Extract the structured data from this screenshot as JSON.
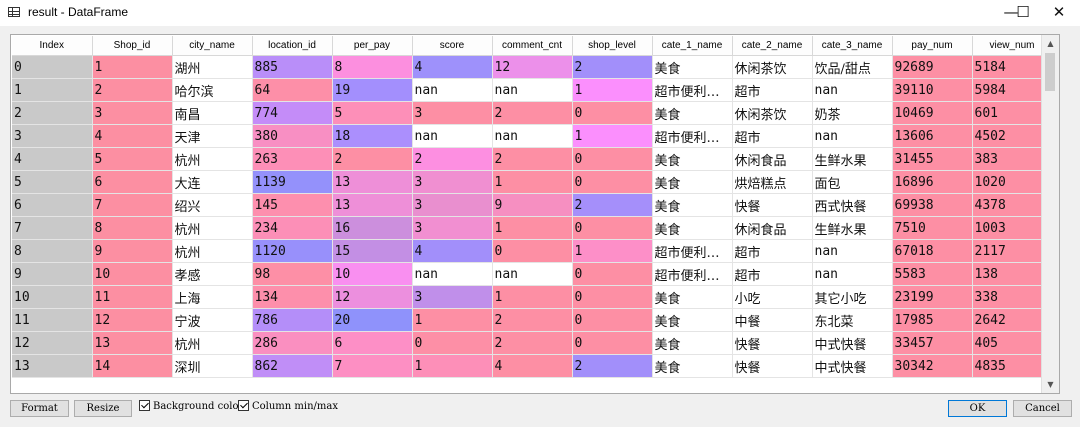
{
  "window": {
    "title": "result - DataFrame",
    "minimize": "—",
    "maximize": "☐",
    "close": "✕"
  },
  "table": {
    "columns": [
      "Index",
      "Shop_id",
      "city_name",
      "location_id",
      "per_pay",
      "score",
      "comment_cnt",
      "shop_level",
      "cate_1_name",
      "cate_2_name",
      "cate_3_name",
      "pay_num",
      "view_num"
    ],
    "rows": [
      [
        "0",
        "1",
        "湖州",
        "885",
        "8",
        "4",
        "12",
        "2",
        "美食",
        "休闲茶饮",
        "饮品/甜点",
        "92689",
        "5184"
      ],
      [
        "1",
        "2",
        "哈尔滨",
        "64",
        "19",
        "nan",
        "nan",
        "1",
        "超市便利…",
        "超市",
        "nan",
        "39110",
        "5984"
      ],
      [
        "2",
        "3",
        "南昌",
        "774",
        "5",
        "3",
        "2",
        "0",
        "美食",
        "休闲茶饮",
        "奶茶",
        "10469",
        "601"
      ],
      [
        "3",
        "4",
        "天津",
        "380",
        "18",
        "nan",
        "nan",
        "1",
        "超市便利…",
        "超市",
        "nan",
        "13606",
        "4502"
      ],
      [
        "4",
        "5",
        "杭州",
        "263",
        "2",
        "2",
        "2",
        "0",
        "美食",
        "休闲食品",
        "生鲜水果",
        "31455",
        "383"
      ],
      [
        "5",
        "6",
        "大连",
        "1139",
        "13",
        "3",
        "1",
        "0",
        "美食",
        "烘焙糕点",
        "面包",
        "16896",
        "1020"
      ],
      [
        "6",
        "7",
        "绍兴",
        "145",
        "13",
        "3",
        "9",
        "2",
        "美食",
        "快餐",
        "西式快餐",
        "69938",
        "4378"
      ],
      [
        "7",
        "8",
        "杭州",
        "234",
        "16",
        "3",
        "1",
        "0",
        "美食",
        "休闲食品",
        "生鲜水果",
        "7510",
        "1003"
      ],
      [
        "8",
        "9",
        "杭州",
        "1120",
        "15",
        "4",
        "0",
        "1",
        "超市便利…",
        "超市",
        "nan",
        "67018",
        "2117"
      ],
      [
        "9",
        "10",
        "孝感",
        "98",
        "10",
        "nan",
        "nan",
        "0",
        "超市便利…",
        "超市",
        "nan",
        "5583",
        "138"
      ],
      [
        "10",
        "11",
        "上海",
        "134",
        "12",
        "3",
        "1",
        "0",
        "美食",
        "小吃",
        "其它小吃",
        "23199",
        "338"
      ],
      [
        "11",
        "12",
        "宁波",
        "786",
        "20",
        "1",
        "2",
        "0",
        "美食",
        "中餐",
        "东北菜",
        "17985",
        "2642"
      ],
      [
        "12",
        "13",
        "杭州",
        "286",
        "6",
        "0",
        "2",
        "0",
        "美食",
        "快餐",
        "中式快餐",
        "33457",
        "405"
      ],
      [
        "13",
        "14",
        "深圳",
        "862",
        "7",
        "1",
        "4",
        "2",
        "美食",
        "快餐",
        "中式快餐",
        "30342",
        "4835"
      ]
    ],
    "cell_colors": [
      [
        "#c9c9c9",
        "#fc8fa2",
        "#ffffff",
        "#b98ef9",
        "#fc8fdf",
        "#9e91fb",
        "#ec90ea",
        "#a28ffa",
        "#ffffff",
        "#ffffff",
        "#ffffff",
        "#fd8fa4",
        "#fd8fa4"
      ],
      [
        "#c9c9c9",
        "#fc8fa2",
        "#ffffff",
        "#fd8fa8",
        "#a38ffd",
        "#ffffff",
        "#ffffff",
        "#fb8ffd",
        "#ffffff",
        "#ffffff",
        "#ffffff",
        "#fd8fa4",
        "#fd8fa4"
      ],
      [
        "#c9c9c9",
        "#fc8fa2",
        "#ffffff",
        "#c48cf8",
        "#fd8fb8",
        "#fd8fa4",
        "#fd8fa4",
        "#fd8fa4",
        "#ffffff",
        "#ffffff",
        "#ffffff",
        "#fd8fa4",
        "#fd8fa4"
      ],
      [
        "#c9c9c9",
        "#fc8fa2",
        "#ffffff",
        "#f88fc3",
        "#ab8ffd",
        "#ffffff",
        "#ffffff",
        "#fb8ffd",
        "#ffffff",
        "#ffffff",
        "#ffffff",
        "#fd8fa4",
        "#fd8fa4"
      ],
      [
        "#c9c9c9",
        "#fc8fa2",
        "#ffffff",
        "#fd8fb7",
        "#fd8fa4",
        "#fd8fe1",
        "#fd8fa4",
        "#fd8fa4",
        "#ffffff",
        "#ffffff",
        "#ffffff",
        "#fd8fa4",
        "#fd8fa4"
      ],
      [
        "#c9c9c9",
        "#fc8fa2",
        "#ffffff",
        "#9491fb",
        "#ee8fd8",
        "#f08fd1",
        "#fd8fa4",
        "#fd8fa4",
        "#ffffff",
        "#ffffff",
        "#ffffff",
        "#fd8fa4",
        "#fd8fa4"
      ],
      [
        "#c9c9c9",
        "#fc8fa2",
        "#ffffff",
        "#fd8fae",
        "#ee8fd8",
        "#e98fcf",
        "#f68fc1",
        "#a58ffa",
        "#ffffff",
        "#ffffff",
        "#ffffff",
        "#fd8fa4",
        "#fd8fa4"
      ],
      [
        "#c9c9c9",
        "#fc8fa2",
        "#ffffff",
        "#fc8fb7",
        "#cc8fdd",
        "#f18fd1",
        "#fd8fa4",
        "#fd8fa4",
        "#ffffff",
        "#ffffff",
        "#ffffff",
        "#fd8fa4",
        "#fd8fa4"
      ],
      [
        "#c9c9c9",
        "#fc8fa2",
        "#ffffff",
        "#9890fb",
        "#c38fe4",
        "#a28ffa",
        "#fd8fa4",
        "#fd8fc8",
        "#ffffff",
        "#ffffff",
        "#ffffff",
        "#fd8fa4",
        "#fd8fa4"
      ],
      [
        "#c9c9c9",
        "#fc8fa2",
        "#ffffff",
        "#fd8fa6",
        "#f98ff0",
        "#ffffff",
        "#ffffff",
        "#fd8fa4",
        "#ffffff",
        "#ffffff",
        "#ffffff",
        "#fd8fa4",
        "#fd8fa4"
      ],
      [
        "#c9c9c9",
        "#fc8fa2",
        "#ffffff",
        "#fd8fab",
        "#ec8fde",
        "#c08fea",
        "#fd8fa4",
        "#fd8fa4",
        "#ffffff",
        "#ffffff",
        "#ffffff",
        "#fd8fa4",
        "#fd8fa4"
      ],
      [
        "#c9c9c9",
        "#fc8fa2",
        "#ffffff",
        "#b48ef9",
        "#8f92fb",
        "#fd8fa4",
        "#fd8fa4",
        "#fd8fa4",
        "#ffffff",
        "#ffffff",
        "#ffffff",
        "#fd8fa4",
        "#fd8fa4"
      ],
      [
        "#c9c9c9",
        "#fc8fa2",
        "#ffffff",
        "#fa8fc0",
        "#fd8fc6",
        "#fd8fa6",
        "#fd8fa4",
        "#fd8fa4",
        "#ffffff",
        "#ffffff",
        "#ffffff",
        "#fd8fa4",
        "#fd8fa4"
      ],
      [
        "#c9c9c9",
        "#fc8fa2",
        "#ffffff",
        "#c08ef7",
        "#fd8fc3",
        "#fd8fb8",
        "#fd8fa4",
        "#a28ffa",
        "#ffffff",
        "#ffffff",
        "#ffffff",
        "#fd8fa4",
        "#fd8fa4"
      ]
    ]
  },
  "footer": {
    "format_label": "Format",
    "resize_label": "Resize",
    "background_color_label": "Background color",
    "column_minmax_label": "Column min/max",
    "ok_label": "OK",
    "cancel_label": "Cancel"
  }
}
